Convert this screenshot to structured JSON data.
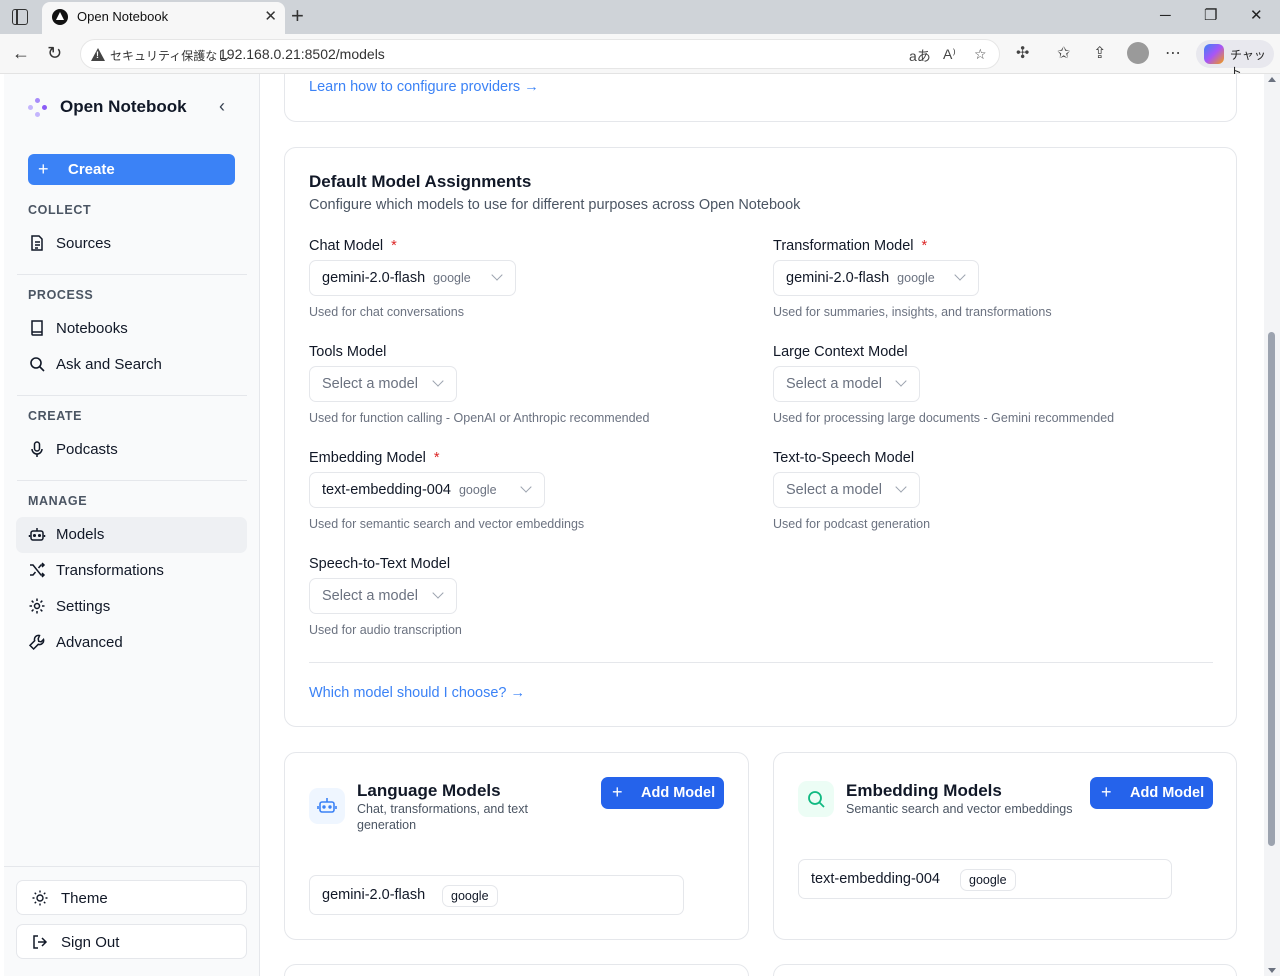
{
  "browser": {
    "tab_title": "Open Notebook",
    "tab_close": "✕",
    "new_tab": "+",
    "security_label": "セキュリティ保護なし",
    "url": "192.168.0.21:8502/models",
    "chat_label": "チャット"
  },
  "sidebar": {
    "brand": "Open Notebook",
    "create_label": "Create",
    "sections": {
      "collect": "COLLECT",
      "process": "PROCESS",
      "create": "CREATE",
      "manage": "MANAGE"
    },
    "items": {
      "sources": "Sources",
      "notebooks": "Notebooks",
      "ask_search": "Ask and Search",
      "podcasts": "Podcasts",
      "models": "Models",
      "transformations": "Transformations",
      "settings": "Settings",
      "advanced": "Advanced"
    },
    "theme_label": "Theme",
    "signout_label": "Sign Out"
  },
  "providers_card": {
    "link": "Learn how to configure providers →"
  },
  "defaults": {
    "title": "Default Model Assignments",
    "subtitle": "Configure which models to use for different purposes across Open Notebook",
    "chat": {
      "label": "Chat Model",
      "value": "gemini-2.0-flash",
      "provider": "google",
      "help": "Used for chat conversations"
    },
    "transformation": {
      "label": "Transformation Model",
      "value": "gemini-2.0-flash",
      "provider": "google",
      "help": "Used for summaries, insights, and transformations"
    },
    "tools": {
      "label": "Tools Model",
      "placeholder": "Select a model",
      "help": "Used for function calling - OpenAI or Anthropic recommended"
    },
    "large_context": {
      "label": "Large Context Model",
      "placeholder": "Select a model",
      "help": "Used for processing large documents - Gemini recommended"
    },
    "embedding": {
      "label": "Embedding Model",
      "value": "text-embedding-004",
      "provider": "google",
      "help": "Used for semantic search and vector embeddings"
    },
    "tts": {
      "label": "Text-to-Speech Model",
      "placeholder": "Select a model",
      "help": "Used for podcast generation"
    },
    "stt": {
      "label": "Speech-to-Text Model",
      "placeholder": "Select a model",
      "help": "Used for audio transcription"
    },
    "required_mark": "*",
    "choose_link": "Which model should I choose? →"
  },
  "language_models": {
    "title": "Language Models",
    "subtitle": "Chat, transformations, and text generation",
    "add_label": "Add Model",
    "models": [
      {
        "name": "gemini-2.0-flash",
        "provider": "google"
      }
    ]
  },
  "embedding_models": {
    "title": "Embedding Models",
    "subtitle": "Semantic search and vector embeddings",
    "add_label": "Add Model",
    "models": [
      {
        "name": "text-embedding-004",
        "provider": "google"
      }
    ]
  },
  "colors": {
    "accent": "#3b82f6",
    "required": "#dc2626",
    "language_icon_bg": "#eff6ff",
    "embedding_icon_bg": "#ecfdf5"
  }
}
